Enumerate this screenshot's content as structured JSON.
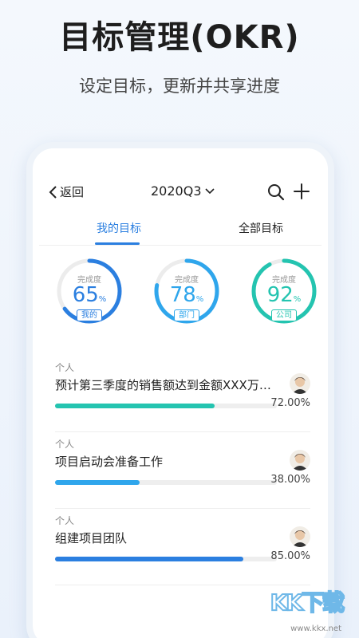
{
  "hero": {
    "title": "目标管理(OKR)",
    "subtitle": "设定目标，更新并共享进度"
  },
  "navbar": {
    "back_label": "返回",
    "period": "2020Q3"
  },
  "tabs": [
    {
      "label": "我的目标",
      "active": true
    },
    {
      "label": "全部目标",
      "active": false
    }
  ],
  "rings": [
    {
      "caption": "完成度",
      "value": "65",
      "unit": "%",
      "tag": "我的",
      "percent": 65,
      "color": "#2b7fe0"
    },
    {
      "caption": "完成度",
      "value": "78",
      "unit": "%",
      "tag": "部门",
      "percent": 78,
      "color": "#2fa6ec"
    },
    {
      "caption": "完成度",
      "value": "92",
      "unit": "%",
      "tag": "公司",
      "percent": 92,
      "color": "#24c4b0"
    }
  ],
  "okrs": [
    {
      "type": "个人",
      "title": "预计第三季度的销售额达到金额XXX万…",
      "progress": 72,
      "progress_label": "72.00%",
      "color": "#24c4b0"
    },
    {
      "type": "个人",
      "title": "项目启动会准备工作",
      "progress": 38,
      "progress_label": "38.00%",
      "color": "#2fa6ec"
    },
    {
      "type": "个人",
      "title": "组建项目团队",
      "progress": 85,
      "progress_label": "85.00%",
      "color": "#2b7fe0"
    }
  ],
  "watermark": {
    "brand": "KK下载",
    "url": "www.kkx.net"
  },
  "icons": {
    "back": "chevron-left-icon",
    "dropdown": "chevron-down-icon",
    "search": "search-icon",
    "add": "plus-icon"
  }
}
